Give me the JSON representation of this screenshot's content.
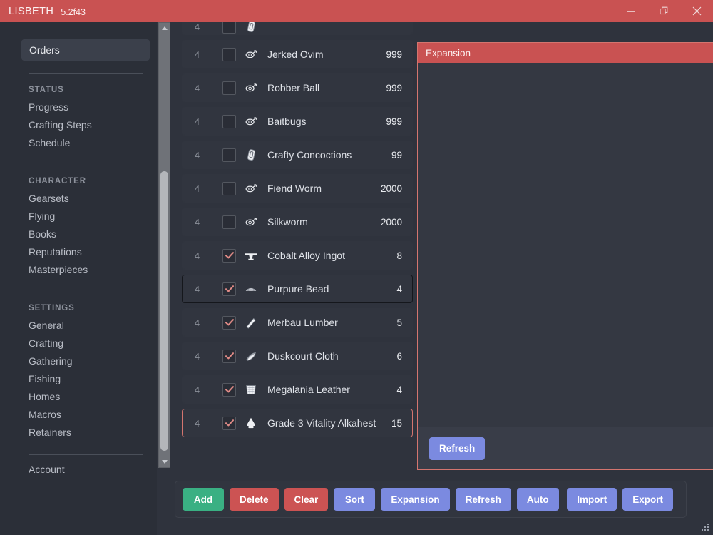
{
  "titlebar": {
    "app_name": "LISBETH",
    "version": "5.2f43",
    "minimize_label": "Minimize",
    "maximize_label": "Restore",
    "close_label": "Close",
    "bg_color": "#c95252"
  },
  "sidebar": {
    "active_item": "Orders",
    "groups": [
      {
        "header": "STATUS",
        "items": [
          "Progress",
          "Crafting Steps",
          "Schedule"
        ]
      },
      {
        "header": "CHARACTER",
        "items": [
          "Gearsets",
          "Flying",
          "Books",
          "Reputations",
          "Masterpieces"
        ]
      },
      {
        "header": "SETTINGS",
        "items": [
          "General",
          "Crafting",
          "Gathering",
          "Fishing",
          "Homes",
          "Macros",
          "Retainers"
        ]
      }
    ],
    "footer_item": "Account"
  },
  "order_list": {
    "rows": [
      {
        "qty": "4",
        "checked": false,
        "icon": "potion-icon",
        "name": "",
        "count": "",
        "state": "partial"
      },
      {
        "qty": "4",
        "checked": false,
        "icon": "worm-icon",
        "name": "Jerked Ovim",
        "count": "999",
        "state": "normal"
      },
      {
        "qty": "4",
        "checked": false,
        "icon": "worm-icon",
        "name": "Robber Ball",
        "count": "999",
        "state": "normal"
      },
      {
        "qty": "4",
        "checked": false,
        "icon": "worm-icon",
        "name": "Baitbugs",
        "count": "999",
        "state": "normal"
      },
      {
        "qty": "4",
        "checked": false,
        "icon": "potion-icon",
        "name": "Crafty Concoctions",
        "count": "99",
        "state": "normal"
      },
      {
        "qty": "4",
        "checked": false,
        "icon": "worm-icon",
        "name": "Fiend Worm",
        "count": "2000",
        "state": "normal"
      },
      {
        "qty": "4",
        "checked": false,
        "icon": "worm-icon",
        "name": "Silkworm",
        "count": "2000",
        "state": "normal"
      },
      {
        "qty": "4",
        "checked": true,
        "icon": "ingot-icon",
        "name": "Cobalt Alloy Ingot",
        "count": "8",
        "state": "normal"
      },
      {
        "qty": "4",
        "checked": true,
        "icon": "bead-icon",
        "name": "Purpure Bead",
        "count": "4",
        "state": "hovered"
      },
      {
        "qty": "4",
        "checked": true,
        "icon": "lumber-icon",
        "name": "Merbau Lumber",
        "count": "5",
        "state": "normal"
      },
      {
        "qty": "4",
        "checked": true,
        "icon": "cloth-icon",
        "name": "Duskcourt Cloth",
        "count": "6",
        "state": "normal"
      },
      {
        "qty": "4",
        "checked": true,
        "icon": "leather-icon",
        "name": "Megalania Leather",
        "count": "4",
        "state": "normal"
      },
      {
        "qty": "4",
        "checked": true,
        "icon": "alkahest-icon",
        "name": "Grade 3 Vitality Alkahest",
        "count": "15",
        "state": "selected"
      }
    ]
  },
  "expansion_window": {
    "title": "Expansion",
    "refresh_label": "Refresh",
    "accent_color": "#c95252"
  },
  "button_bar": {
    "left_buttons": [
      {
        "label": "Add",
        "color": "green"
      },
      {
        "label": "Delete",
        "color": "red"
      },
      {
        "label": "Clear",
        "color": "red"
      },
      {
        "label": "Sort",
        "color": "blue"
      },
      {
        "label": "Expansion",
        "color": "blue"
      },
      {
        "label": "Refresh",
        "color": "blue"
      },
      {
        "label": "Auto",
        "color": "blue"
      }
    ],
    "right_buttons": [
      {
        "label": "Import",
        "color": "blue"
      },
      {
        "label": "Export",
        "color": "blue"
      }
    ]
  },
  "scrollbar": {
    "up_arrow": "scroll-up-arrow",
    "down_arrow": "scroll-down-arrow"
  }
}
